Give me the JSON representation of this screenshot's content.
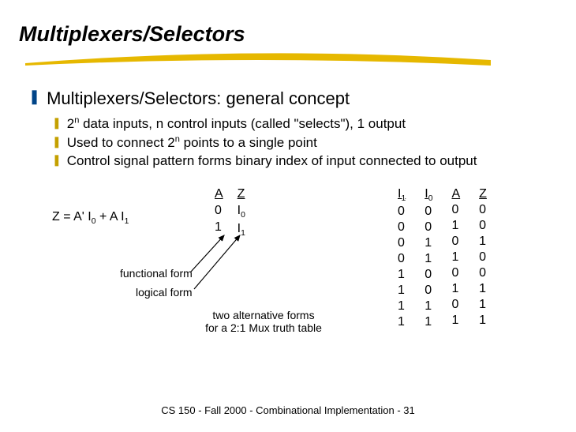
{
  "title": "Multiplexers/Selectors",
  "heading": "Multiplexers/Selectors: general concept",
  "bullets": {
    "b1_pre": "2",
    "b1_sup": "n",
    "b1_post": " data inputs, n control inputs (called \"selects\"), 1 output",
    "b2_pre": "Used to connect 2",
    "b2_sup": "n",
    "b2_post": " points to a single point",
    "b3": "Control signal pattern forms binary index of input connected to output"
  },
  "func": {
    "lhs": "Z = A' I",
    "s0": "0",
    "mid": "  + A I",
    "s1": "1"
  },
  "table2": {
    "h1": "A",
    "h2": "Z",
    "r1c1": "0",
    "r1c2": "I",
    "r1c2s": "0",
    "r2c1": "1",
    "r2c2": "I",
    "r2c2s": "1"
  },
  "table4": {
    "h1": "I",
    "h1s": "1",
    "h2": "I",
    "h2s": "0",
    "h3": "A",
    "h4": "Z",
    "c1": [
      "0",
      "0",
      "0",
      "0",
      "1",
      "1",
      "1",
      "1"
    ],
    "c2": [
      "0",
      "0",
      "1",
      "1",
      "0",
      "0",
      "1",
      "1"
    ],
    "c3": [
      "0",
      "1",
      "0",
      "1",
      "0",
      "1",
      "0",
      "1"
    ],
    "c4": [
      "0",
      "0",
      "1",
      "0",
      "0",
      "1",
      "1",
      "1"
    ]
  },
  "labels": {
    "func": "functional form",
    "logic": "logical form",
    "caption1": "two alternative forms",
    "caption2": "for a 2:1 Mux truth table"
  },
  "footer": "CS 150 - Fall 2000 - Combinational Implementation - 31"
}
